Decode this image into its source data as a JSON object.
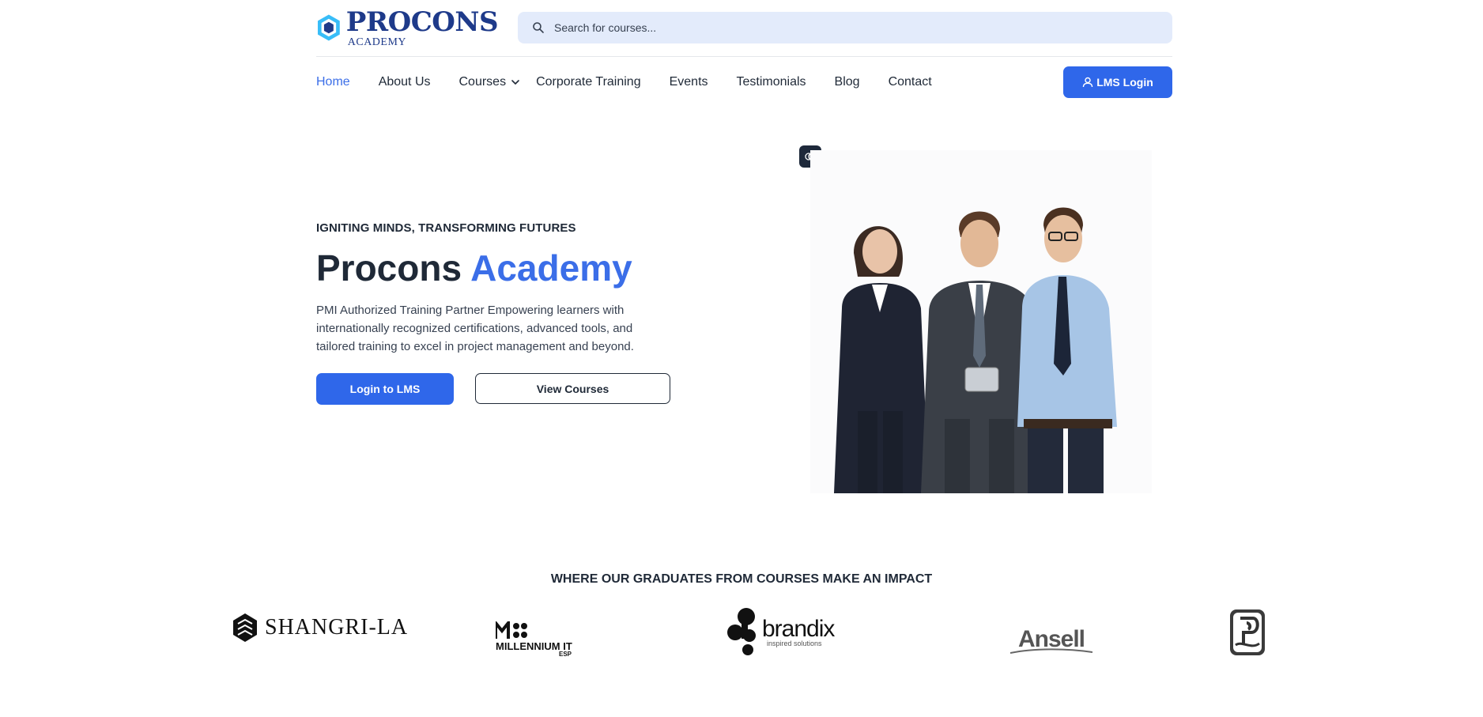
{
  "brand": {
    "name": "PROCONS",
    "sub": "ACADEMY",
    "primary_color": "#2f67ea",
    "dark_color": "#1e3a8a"
  },
  "search": {
    "placeholder": "Search for courses..."
  },
  "nav": {
    "items": [
      {
        "label": "Home",
        "active": true
      },
      {
        "label": "About Us"
      },
      {
        "label": "Courses",
        "has_dropdown": true
      },
      {
        "label": "Corporate Training"
      },
      {
        "label": "Events"
      },
      {
        "label": "Testimonials"
      },
      {
        "label": "Blog"
      },
      {
        "label": "Contact"
      }
    ],
    "login_label": "LMS Login"
  },
  "hero": {
    "tagline": "IGNITING MINDS, TRANSFORMING FUTURES",
    "title_main": "Procons",
    "title_accent": "Academy",
    "description": "PMI Authorized Training Partner Empowering learners with internationally recognized certifications, advanced tools, and tailored training to excel in project management and beyond.",
    "primary_button": "Login to LMS",
    "secondary_button": "View Courses"
  },
  "partners": {
    "title": "WHERE OUR GRADUATES FROM COURSES MAKE AN IMPACT",
    "logos": [
      {
        "text": "SHANGRI-LA"
      },
      {
        "text": "MILLENNIUM IT",
        "sub": "ESP"
      },
      {
        "text": "brandix",
        "sub": "inspired solutions"
      },
      {
        "text": "Ansell"
      }
    ]
  }
}
